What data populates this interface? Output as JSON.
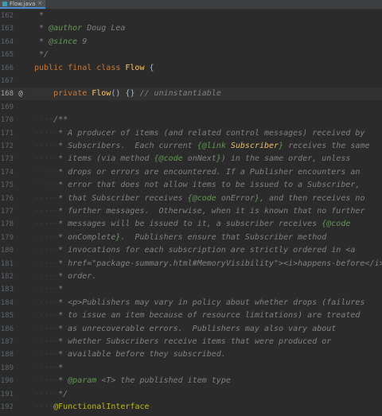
{
  "tab": {
    "file": "Flow.java",
    "close": "×"
  },
  "gutter": {
    "override_marker": "@"
  },
  "lines": [
    {
      "n": "162",
      "parts": [
        [
          "cmt",
          " *"
        ]
      ]
    },
    {
      "n": "163",
      "parts": [
        [
          "cmt",
          " * "
        ],
        [
          "tag",
          "@author"
        ],
        [
          "cmt",
          " Doug Lea"
        ]
      ]
    },
    {
      "n": "164",
      "parts": [
        [
          "cmt",
          " * "
        ],
        [
          "tag",
          "@since"
        ],
        [
          "cmt",
          " 9"
        ]
      ]
    },
    {
      "n": "165",
      "parts": [
        [
          "cmt",
          " */"
        ]
      ]
    },
    {
      "n": "166",
      "parts": [
        [
          "kw",
          "public final class "
        ],
        [
          "class",
          "Flow "
        ],
        [
          "brace",
          "{"
        ]
      ]
    },
    {
      "n": "167",
      "parts": []
    },
    {
      "n": "168",
      "current": true,
      "marker": true,
      "parts": [
        [
          "dots",
          "····"
        ],
        [
          "kw",
          "private "
        ],
        [
          "fn",
          "Flow"
        ],
        [
          "plain",
          "() {} "
        ],
        [
          "cmt",
          "// uninstantiable"
        ]
      ]
    },
    {
      "n": "169",
      "parts": []
    },
    {
      "n": "170",
      "parts": [
        [
          "dots",
          "····"
        ],
        [
          "cmt",
          "/**"
        ]
      ]
    },
    {
      "n": "171",
      "parts": [
        [
          "dots",
          "·····"
        ],
        [
          "cmt",
          "* A producer of items (and related control messages) received by"
        ]
      ]
    },
    {
      "n": "172",
      "parts": [
        [
          "dots",
          "·····"
        ],
        [
          "cmt",
          "* Subscribers.  Each current "
        ],
        [
          "tag",
          "{@link "
        ],
        [
          "cls",
          "Subscriber"
        ],
        [
          "tag",
          "}"
        ],
        [
          "cmt",
          " receives the same"
        ]
      ]
    },
    {
      "n": "173",
      "parts": [
        [
          "dots",
          "·····"
        ],
        [
          "cmt",
          "* items (via method "
        ],
        [
          "tag",
          "{@code "
        ],
        [
          "cmt",
          "onNext"
        ],
        [
          "tag",
          "}"
        ],
        [
          "cmt",
          ") in the same order, unless"
        ]
      ]
    },
    {
      "n": "174",
      "parts": [
        [
          "dots",
          "·····"
        ],
        [
          "cmt",
          "* drops or errors are encountered. If a Publisher encounters an"
        ]
      ]
    },
    {
      "n": "175",
      "parts": [
        [
          "dots",
          "·····"
        ],
        [
          "cmt",
          "* error that does not allow items to be issued to a Subscriber,"
        ]
      ]
    },
    {
      "n": "176",
      "parts": [
        [
          "dots",
          "·····"
        ],
        [
          "cmt",
          "* that Subscriber receives "
        ],
        [
          "tag",
          "{@code "
        ],
        [
          "cmt",
          "onError"
        ],
        [
          "tag",
          "}"
        ],
        [
          "cmt",
          ", and then receives no"
        ]
      ]
    },
    {
      "n": "177",
      "parts": [
        [
          "dots",
          "·····"
        ],
        [
          "cmt",
          "* further messages.  Otherwise, when it is known that no further"
        ]
      ]
    },
    {
      "n": "178",
      "parts": [
        [
          "dots",
          "·····"
        ],
        [
          "cmt",
          "* messages will be issued to it, a subscriber receives "
        ],
        [
          "tag",
          "{@code"
        ]
      ]
    },
    {
      "n": "179",
      "parts": [
        [
          "dots",
          "·····"
        ],
        [
          "cmt",
          "* onComplete"
        ],
        [
          "tag",
          "}"
        ],
        [
          "cmt",
          ".  Publishers ensure that Subscriber method"
        ]
      ]
    },
    {
      "n": "180",
      "parts": [
        [
          "dots",
          "·····"
        ],
        [
          "cmt",
          "* invocations for each subscription are strictly ordered in <a"
        ]
      ]
    },
    {
      "n": "181",
      "parts": [
        [
          "dots",
          "·····"
        ],
        [
          "cmt",
          "* href=\"package-summary.html#MemoryVisibility\"><i>happens-before</i></a>"
        ]
      ]
    },
    {
      "n": "182",
      "parts": [
        [
          "dots",
          "·····"
        ],
        [
          "cmt",
          "* order."
        ]
      ]
    },
    {
      "n": "183",
      "parts": [
        [
          "dots",
          "·····"
        ],
        [
          "cmt",
          "*"
        ]
      ]
    },
    {
      "n": "184",
      "parts": [
        [
          "dots",
          "·····"
        ],
        [
          "cmt",
          "* <p>Publishers may vary in policy about whether drops (failures"
        ]
      ]
    },
    {
      "n": "185",
      "parts": [
        [
          "dots",
          "·····"
        ],
        [
          "cmt",
          "* to issue an item because of resource limitations) are treated"
        ]
      ]
    },
    {
      "n": "186",
      "parts": [
        [
          "dots",
          "·····"
        ],
        [
          "cmt",
          "* as unrecoverable errors.  Publishers may also vary about"
        ]
      ]
    },
    {
      "n": "187",
      "parts": [
        [
          "dots",
          "·····"
        ],
        [
          "cmt",
          "* whether Subscribers receive items that were produced or"
        ]
      ]
    },
    {
      "n": "188",
      "parts": [
        [
          "dots",
          "·····"
        ],
        [
          "cmt",
          "* available before they subscribed."
        ]
      ]
    },
    {
      "n": "189",
      "parts": [
        [
          "dots",
          "·····"
        ],
        [
          "cmt",
          "*"
        ]
      ]
    },
    {
      "n": "190",
      "parts": [
        [
          "dots",
          "·····"
        ],
        [
          "cmt",
          "* "
        ],
        [
          "tag",
          "@param "
        ],
        [
          "cmt",
          "<T> the published item type"
        ]
      ]
    },
    {
      "n": "191",
      "parts": [
        [
          "dots",
          "·····"
        ],
        [
          "cmt",
          "*/"
        ]
      ]
    },
    {
      "n": "192",
      "parts": [
        [
          "dots",
          "····"
        ],
        [
          "ann",
          "@FunctionalInterface"
        ]
      ]
    }
  ]
}
